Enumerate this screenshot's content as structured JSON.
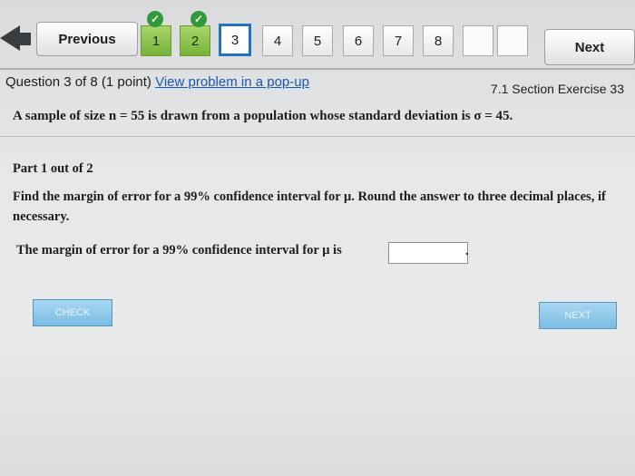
{
  "nav": {
    "previous_label": "Previous",
    "next_label": "Next",
    "questions": [
      {
        "label": "1",
        "status": "done"
      },
      {
        "label": "2",
        "status": "done"
      },
      {
        "label": "3",
        "status": "current"
      },
      {
        "label": "4",
        "status": "todo"
      },
      {
        "label": "5",
        "status": "todo"
      },
      {
        "label": "6",
        "status": "todo"
      },
      {
        "label": "7",
        "status": "todo"
      },
      {
        "label": "8",
        "status": "todo"
      }
    ],
    "check_mark": "✓"
  },
  "question": {
    "header": "Question 3 of 8 (1 point)",
    "popup_link": "View problem in a pop-up",
    "section": "7.1 Section Exercise 33",
    "statement": "A sample of size n = 55 is drawn from a population whose standard deviation is σ = 45.",
    "part": "Part 1 out of 2",
    "task": "Find the margin of error for a 99% confidence interval for μ. Round the answer to three decimal places, if necessary.",
    "answer_prompt": "The margin of error for a 99% confidence interval for μ is",
    "answer_value": "",
    "period": "."
  },
  "buttons": {
    "check": "CHECK",
    "next": "NEXT"
  },
  "colors": {
    "accent": "#1f73c9",
    "done_green": "#78b43a",
    "link": "#1658b3"
  }
}
